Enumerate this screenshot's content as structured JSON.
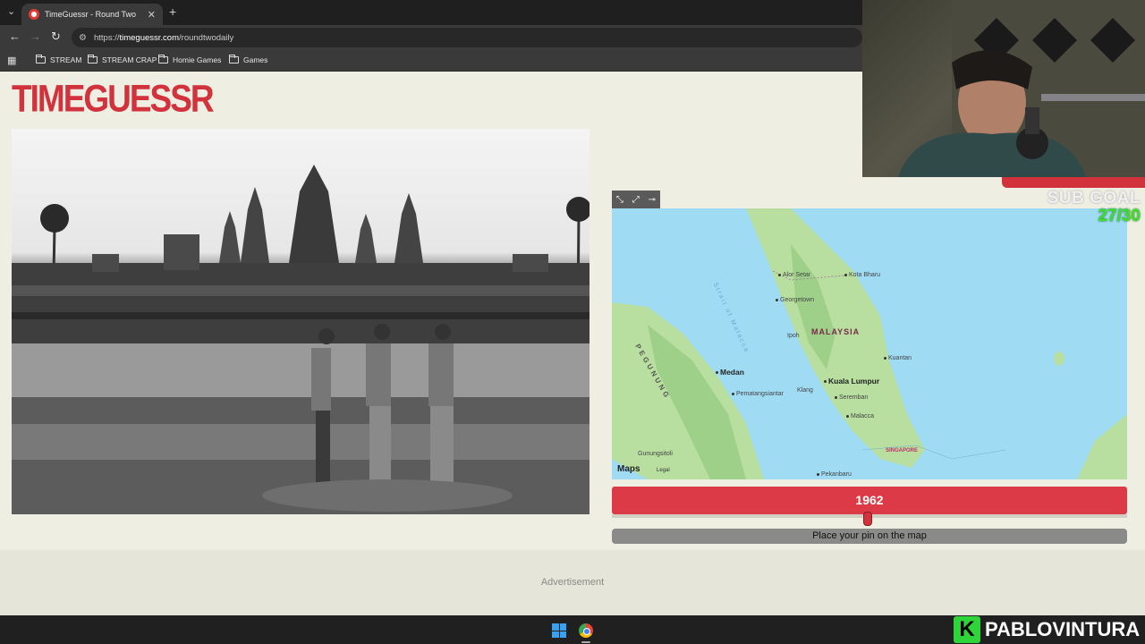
{
  "browser": {
    "tab_title": "TimeGuessr - Round Two",
    "url_prefix": "https://",
    "url_domain": "timeguessr.com",
    "url_path": "/roundtwodaily",
    "bookmarks": [
      "STREAM",
      "STREAM CRAP",
      "Homie Games",
      "Games"
    ]
  },
  "page": {
    "logo": "TIMEGUESSR",
    "year": "1962",
    "pin_prompt": "Place your pin on the map",
    "advertisement": "Advertisement"
  },
  "map": {
    "attribution": "Maps",
    "legal": "Legal",
    "country": "MALAYSIA",
    "region": "PEGUNUNG",
    "strait": "Strait of Malacca",
    "cities": {
      "alor_setar": "Alor Setar",
      "kota_bharu": "Kota Bharu",
      "georgetown": "Georgetown",
      "ipoh": "Ipoh",
      "kuantan": "Kuantan",
      "medan": "Medan",
      "kuala_lumpur": "Kuala Lumpur",
      "klang": "Klang",
      "pematangsiantar": "Pematangsiantar",
      "seremban": "Seremban",
      "malacca": "Malacca",
      "gunungsitoli": "Gunungsitoli",
      "singapore": "SINGAPORE",
      "pekanbaru": "Pekanbaru"
    }
  },
  "stream": {
    "sub_goal_label": "SUB GOAL",
    "sub_goal_count": "27/30",
    "brand_letter": "K",
    "brand_name": "PABLOVINTURA"
  },
  "colors": {
    "brand_red": "#d2323c",
    "sub_green": "#3de02a",
    "map_water": "#9fdcf4",
    "map_land": "#b8dfa0"
  }
}
